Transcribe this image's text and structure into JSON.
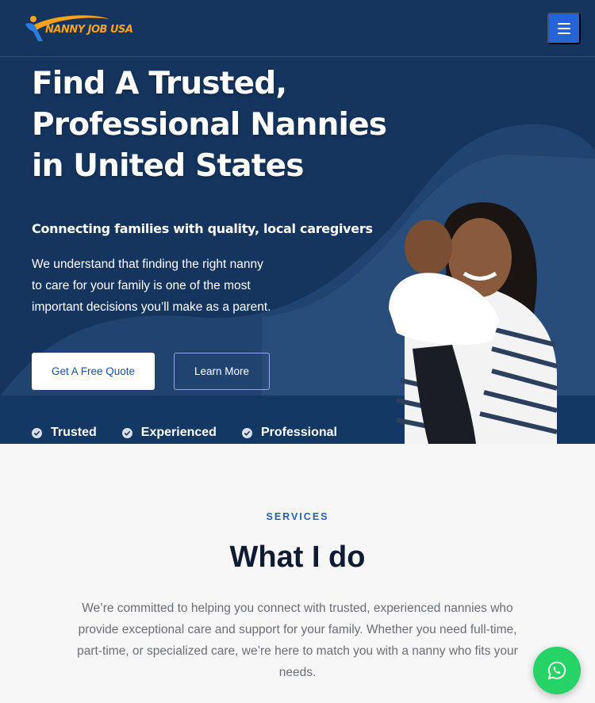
{
  "header": {
    "logo_text": "NANNY JOB USA",
    "menu_icon": "hamburger-menu-icon"
  },
  "hero": {
    "title_line1": "Find A Trusted,",
    "title_line2": "Professional Nannies",
    "title_line3": "in United States",
    "subtitle": "Connecting families with quality, local caregivers",
    "description_line1": "We understand that finding the right nanny",
    "description_line2": "to care for your family is one of the most",
    "description_line3": "important decisions you’ll make as a parent.",
    "primary_button": "Get A Free Quote",
    "secondary_button": "Learn More",
    "features": [
      "Trusted",
      "Experienced",
      "Professional"
    ]
  },
  "services": {
    "eyebrow": "SERVICES",
    "title": "What I do",
    "description_line1": "We’re committed to helping you connect with trusted, experienced nannies who",
    "description_line2": "provide exceptional care and support for your family. Whether you need full-time,",
    "description_line3": "part-time, or specialized care, we’re here to match you with a nanny who fits your",
    "description_line4": "needs."
  },
  "colors": {
    "hero_bg": "#15355f",
    "accent_blue": "#2563d6",
    "logo_orange": "#f6a21c",
    "whatsapp_green": "#25d366",
    "heading_dark": "#0f1b33"
  },
  "floating": {
    "chat_icon": "whatsapp-icon"
  }
}
